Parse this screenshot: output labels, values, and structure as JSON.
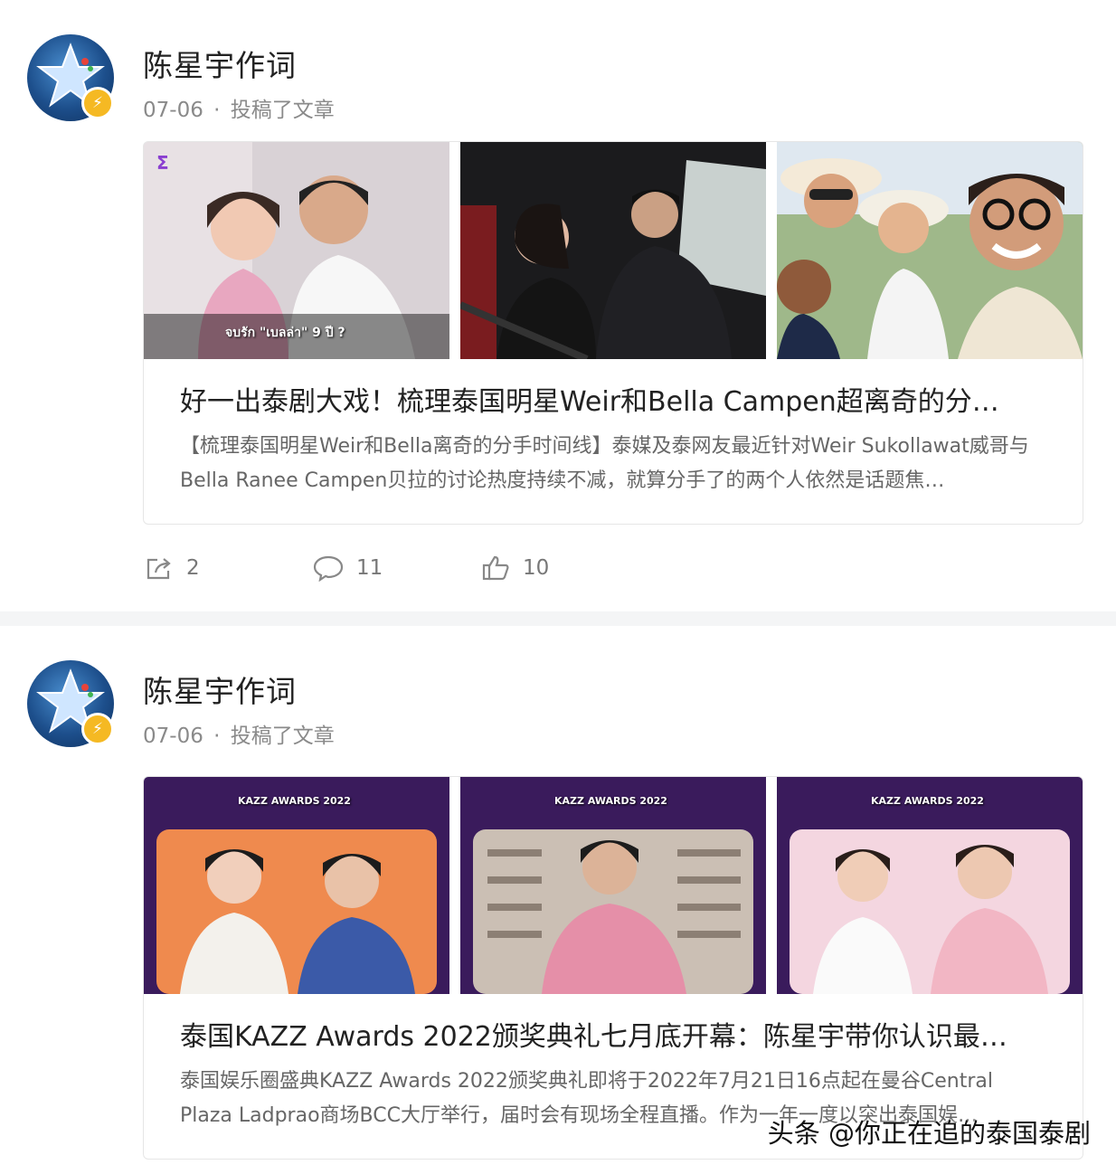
{
  "posts": [
    {
      "author": "陈星宇作词",
      "date": "07-06",
      "separator": "·",
      "action_text": "投稿了文章",
      "article": {
        "title": "好一出泰剧大戏！梳理泰国明星Weir和Bella Campen超离奇的分…",
        "summary": "【梳理泰国明星Weir和Bella离奇的分手时间线】泰媒及泰网友最近针对Weir Sukollawat威哥与Bella Ranee Campen贝拉的讨论热度持续不减，就算分手了的两个人依然是话题焦…",
        "thumb_caption": "จบรัก \"เบลล่า\" 9 ปี ?"
      },
      "stats": {
        "shares": "2",
        "comments": "11",
        "likes": "10"
      }
    },
    {
      "author": "陈星宇作词",
      "date": "07-06",
      "separator": "·",
      "action_text": "投稿了文章",
      "article": {
        "title": "泰国KAZZ Awards 2022颁奖典礼七月底开幕：陈星宇带你认识最…",
        "summary": "泰国娱乐圈盛典KAZZ Awards 2022颁奖典礼即将于2022年7月21日16点起在曼谷Central Plaza Ladprao商场BCC大厅举行，届时会有现场全程直播。作为一年一度以突出泰国娱…",
        "banner_text": "KAZZ AWARDS 2022"
      }
    }
  ],
  "watermark": "头条 @你正在追的泰国泰剧",
  "colors": {
    "badge": "#f5b923",
    "banner_purple": "#3a1b5c"
  }
}
